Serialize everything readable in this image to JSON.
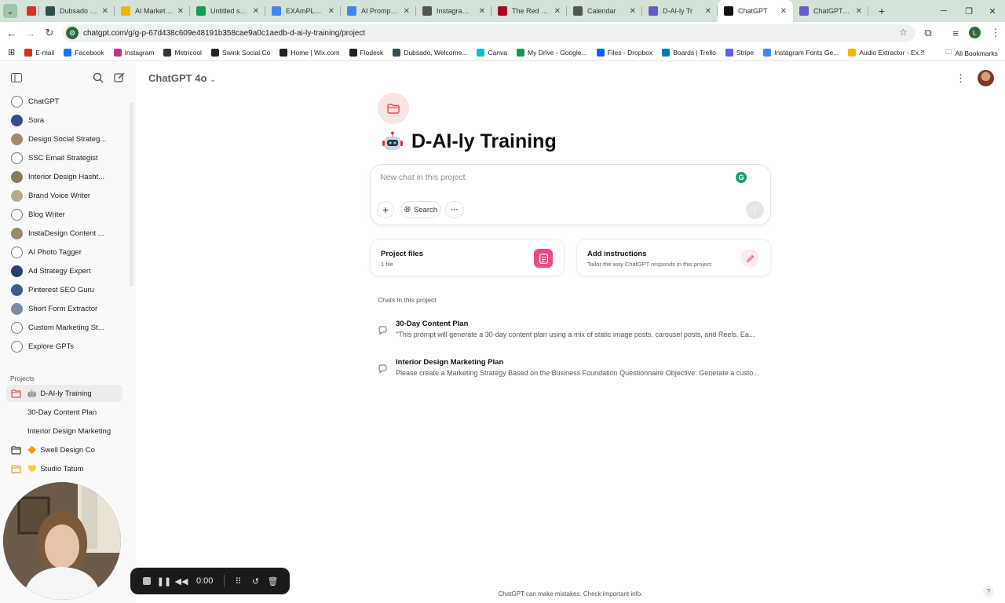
{
  "browser": {
    "tabs": [
      {
        "title": "",
        "color": "#d93025",
        "active": false
      },
      {
        "title": "Dubsado CRM",
        "color": "#2f4f4f",
        "active": false
      },
      {
        "title": "AI Marketing",
        "color": "#f4b400",
        "active": false
      },
      {
        "title": "Untitled sprea",
        "color": "#0f9d58",
        "active": false
      },
      {
        "title": "EXAmPLE - Go",
        "color": "#4285f4",
        "active": false
      },
      {
        "title": "AI Prompts - G",
        "color": "#4285f4",
        "active": false
      },
      {
        "title": "Instagram Str",
        "color": "#555555",
        "active": false
      },
      {
        "title": "The Red Shutt",
        "color": "#b00020",
        "active": false
      },
      {
        "title": "Calendar",
        "color": "#555555",
        "active": false
      },
      {
        "title": "D-AI-ly Tr",
        "color": "#6a5acd",
        "active": false
      },
      {
        "title": "ChatGPT",
        "color": "#111111",
        "active": true
      },
      {
        "title": "ChatGPT - 🤖",
        "color": "#6a5acd",
        "active": false
      }
    ],
    "url": "chatgpt.com/g/g-p-67d438c609e48191b358cae9a0c1aedb-d-ai-ly-training/project",
    "profile_initial": "L",
    "bookmarks": [
      {
        "label": "E-mail",
        "color": "#d93025"
      },
      {
        "label": "Facebook",
        "color": "#1877f2"
      },
      {
        "label": "Instagram",
        "color": "#c13584"
      },
      {
        "label": "Metricool",
        "color": "#333333"
      },
      {
        "label": "Swink Social Co",
        "color": "#222222"
      },
      {
        "label": "Home | Wix.com",
        "color": "#222222"
      },
      {
        "label": "Flodesk",
        "color": "#222222"
      },
      {
        "label": "Dubsado, Welcome...",
        "color": "#2f4f4f"
      },
      {
        "label": "Canva",
        "color": "#00c4cc"
      },
      {
        "label": "My Drive - Google...",
        "color": "#0f9d58"
      },
      {
        "label": "Files - Dropbox",
        "color": "#0061ff"
      },
      {
        "label": "Boards | Trello",
        "color": "#0079bf"
      },
      {
        "label": "Stripe",
        "color": "#635bff"
      },
      {
        "label": "Instagram Fonts Ge...",
        "color": "#4285f4"
      },
      {
        "label": "Audio Extractor - Ex...",
        "color": "#f4b400"
      }
    ],
    "all_bookmarks": "All Bookmarks"
  },
  "sidebar": {
    "gpts": [
      {
        "label": "ChatGPT",
        "color": "#ffffff"
      },
      {
        "label": "Sora",
        "color": "#3b4a8c"
      },
      {
        "label": "Design Social Strateg...",
        "color": "#a08a6a"
      },
      {
        "label": "SSC Email Strategist",
        "color": "#ffffff"
      },
      {
        "label": "Interior Design Hasht...",
        "color": "#8a7a5a"
      },
      {
        "label": "Brand Voice Writer",
        "color": "#b8a98a"
      },
      {
        "label": "Blog Writer",
        "color": "#ffffff"
      },
      {
        "label": "InstaDesign Content ...",
        "color": "#9a8a6a"
      },
      {
        "label": "AI Photo Tagger",
        "color": "#ffffff"
      },
      {
        "label": "Ad Strategy Expert",
        "color": "#2a3f6a"
      },
      {
        "label": "Pinterest SEO Guru",
        "color": "#3a5a8a"
      },
      {
        "label": "Short Form Extractor",
        "color": "#7a8aa0"
      },
      {
        "label": "Custom Marketing St...",
        "color": "#ffffff"
      },
      {
        "label": "Explore GPTs",
        "color": "#ffffff"
      }
    ],
    "projects_label": "Projects",
    "projects": [
      {
        "label": "D-AI-ly Training",
        "emoji": "🤖",
        "active": true,
        "folder_color": "#d9534f"
      },
      {
        "label": "30-Day Content Plan",
        "sub": true
      },
      {
        "label": "Interior Design Marketing",
        "sub": true
      },
      {
        "label": "Swell Design Co",
        "emoji": "🔶",
        "folder_color": "#333333"
      },
      {
        "label": "Studio Tatum",
        "emoji": "💛",
        "folder_color": "#e0a030"
      }
    ]
  },
  "main": {
    "model": "ChatGPT 4o",
    "project_title": "D-AI-ly Training",
    "composer_placeholder": "New chat in this project",
    "search_label": "Search",
    "cards": [
      {
        "title": "Project files",
        "subtitle": "1 file"
      },
      {
        "title": "Add instructions",
        "subtitle": "Tailor the way ChatGPT responds in this project"
      }
    ],
    "chats_heading": "Chats in this project",
    "chats": [
      {
        "title": "30-Day Content Plan",
        "preview": "\"This prompt will generate a 30-day content plan using a mix of static image posts, carousel posts, and Reels. Ea..."
      },
      {
        "title": "Interior Design Marketing Plan",
        "preview": "Please create a Marketing Strategy Based on the Business Foundation Questionnaire Objective: Generate a custo..."
      }
    ],
    "footer": "ChatGPT can make mistakes. Check important info."
  },
  "recorder": {
    "time": "0:00"
  },
  "colors": {
    "accent_pink": "#e84b86",
    "folder_red": "#d9534f"
  }
}
